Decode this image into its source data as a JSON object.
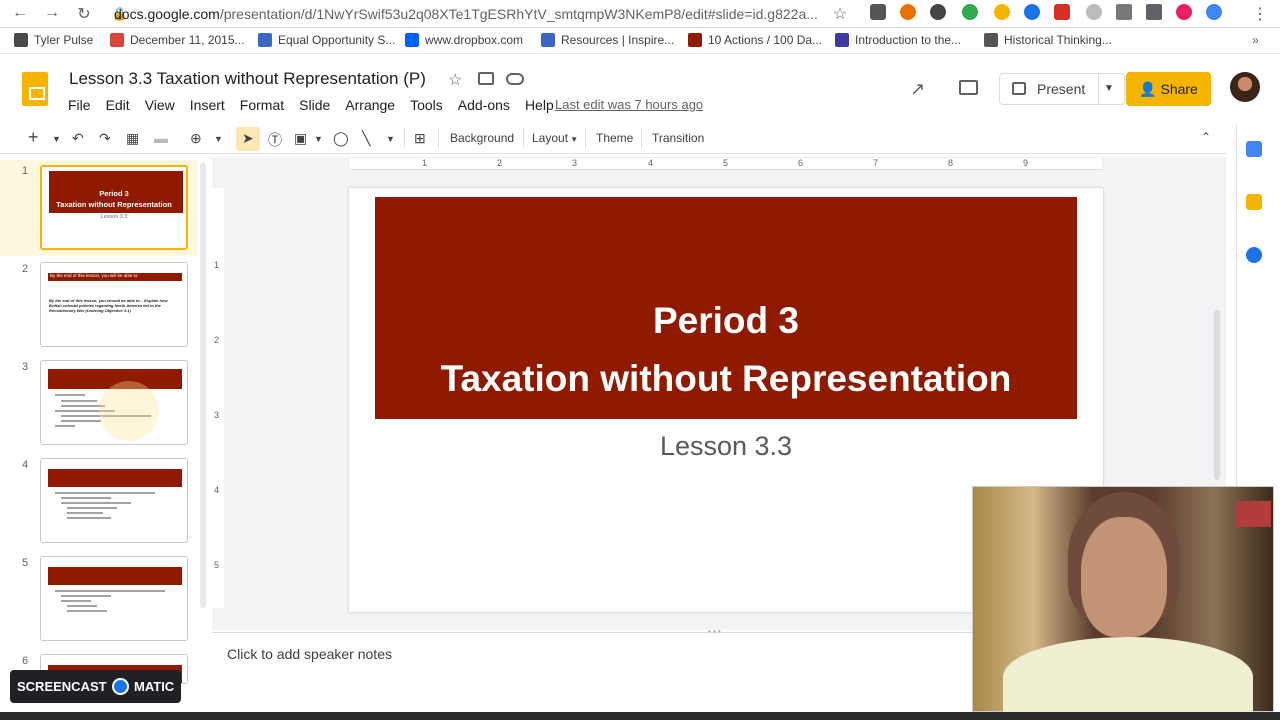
{
  "browser": {
    "url_host": "docs.google.com",
    "url_path": "/presentation/d/1NwYrSwif53u2q08XTe1TgESRhYtV_smtqmpW3NKemP8/edit#slide=id.g822a...",
    "nav_icons": [
      "back-icon",
      "forward-icon",
      "reload-icon",
      "lock-icon"
    ],
    "bookmarks": [
      {
        "label": "Tyler Pulse",
        "color": "#4a4a4a"
      },
      {
        "label": "December 11, 2015...",
        "color": "#db4437"
      },
      {
        "label": "Equal Opportunity S...",
        "color": "#3b66c4"
      },
      {
        "label": "www.dropbox.com",
        "color": "#0061ff"
      },
      {
        "label": "Resources | Inspire...",
        "color": "#3b66c4"
      },
      {
        "label": "10 Actions / 100 Da...",
        "color": "#8f1a00"
      },
      {
        "label": "Introduction to the...",
        "color": "#3b3b9f"
      },
      {
        "label": "Historical Thinking...",
        "color": "#555555"
      }
    ]
  },
  "doc": {
    "title": "Lesson 3.3 Taxation without Representation (P)",
    "menu": [
      "File",
      "Edit",
      "View",
      "Insert",
      "Format",
      "Slide",
      "Arrange",
      "Tools",
      "Add-ons",
      "Help"
    ],
    "last_edit": "Last edit was 7 hours ago",
    "present_label": "Present",
    "share_label": "Share",
    "brand_color": "#f4b400"
  },
  "toolbar": {
    "background": "Background",
    "layout": "Layout",
    "theme": "Theme",
    "transition": "Transition"
  },
  "ruler": {
    "marks": [
      "1",
      "2",
      "3",
      "4",
      "5",
      "6",
      "7",
      "8",
      "9"
    ],
    "left_marks": [
      "1",
      "2",
      "3",
      "4",
      "5"
    ]
  },
  "filmstrip": {
    "slides": [
      {
        "num": "1",
        "title": "Period 3",
        "title2": "Taxation without Representation",
        "sub": "Lesson 3.3"
      },
      {
        "num": "2",
        "banner_text": "By the end of this lesson, you will be able to:",
        "body": "By the end of this lesson, you should be able to... Explain how British colonial policies regarding North America led to the Revolutionary War (Learning Objective 3.1)"
      },
      {
        "num": "3"
      },
      {
        "num": "4"
      },
      {
        "num": "5"
      },
      {
        "num": "6"
      }
    ]
  },
  "slide": {
    "title_line1": "Period 3",
    "title_line2": "Taxation without Representation",
    "subtitle": "Lesson 3.3",
    "banner_color": "#8f1a00"
  },
  "notes": {
    "placeholder": "Click to add speaker notes"
  },
  "watermark": {
    "left": "SCREENCAST",
    "right": "MATIC"
  }
}
